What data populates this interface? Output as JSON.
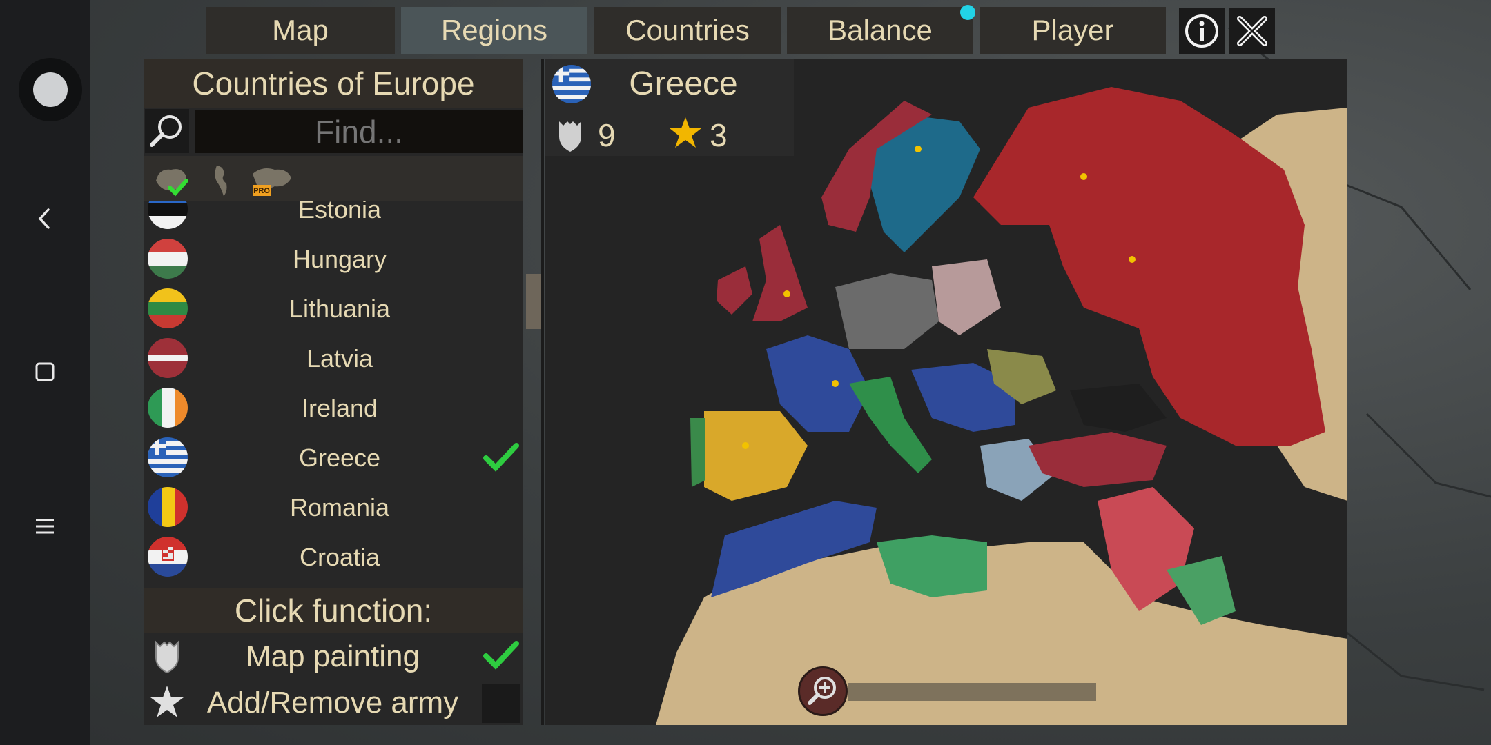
{
  "nav": {
    "buttons": [
      "map",
      "regions",
      "countries",
      "balance",
      "player"
    ]
  },
  "tabs": [
    {
      "label": "Map",
      "active": false
    },
    {
      "label": "Regions",
      "active": true
    },
    {
      "label": "Countries",
      "active": false
    },
    {
      "label": "Balance",
      "active": false,
      "notification": true
    },
    {
      "label": "Player",
      "active": false
    }
  ],
  "toolbar_icons": [
    "info-icon",
    "close-icon"
  ],
  "left_panel": {
    "title": "Countries of Europe",
    "search_placeholder": "Find...",
    "filters": [
      {
        "icon": "europe-map-icon",
        "selected": true
      },
      {
        "icon": "americas-map-icon",
        "selected": false
      },
      {
        "icon": "world-map-pro-icon",
        "selected": false,
        "badge": "PRO"
      }
    ],
    "countries": [
      {
        "name": "Estonia",
        "selected": false
      },
      {
        "name": "Hungary",
        "selected": false
      },
      {
        "name": "Lithuania",
        "selected": false
      },
      {
        "name": "Latvia",
        "selected": false
      },
      {
        "name": "Ireland",
        "selected": false
      },
      {
        "name": "Greece",
        "selected": true
      },
      {
        "name": "Romania",
        "selected": false
      },
      {
        "name": "Croatia",
        "selected": false
      }
    ],
    "click_function_title": "Click function:",
    "functions": [
      {
        "label": "Map painting",
        "checked": true,
        "icon": "shield-icon"
      },
      {
        "label": "Add/Remove army",
        "checked": false,
        "icon": "star-icon"
      }
    ]
  },
  "selected_country": {
    "name": "Greece",
    "regions": "9",
    "armies": "3"
  },
  "colors": {
    "accent_text": "#e6d9b3",
    "check_green": "#2ecc40",
    "notification": "#22d3e6",
    "russia_red": "#a8272b",
    "france_blue": "#2f4a9a",
    "spain_yellow": "#d9a82a",
    "italy_green": "#2f8f4a"
  }
}
